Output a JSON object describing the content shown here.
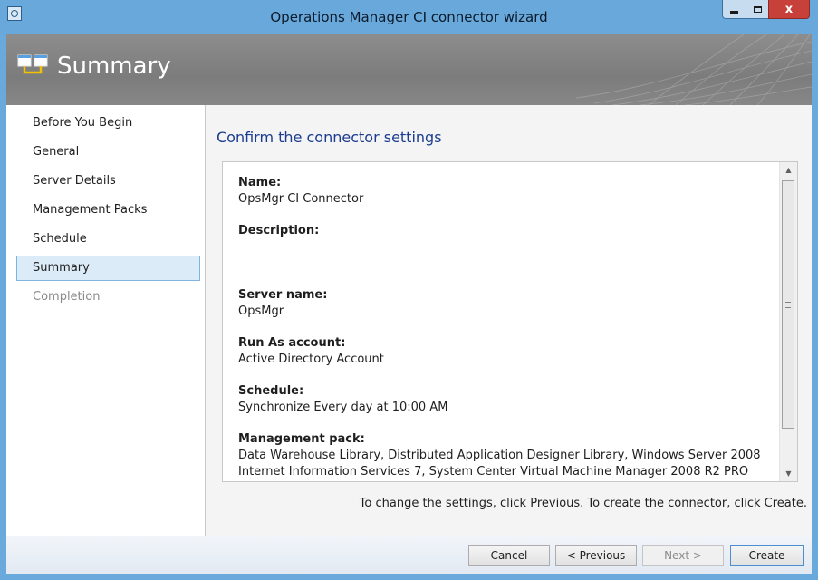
{
  "window": {
    "title": "Operations Manager CI connector wizard",
    "close_glyph": "x"
  },
  "banner": {
    "title": "Summary",
    "icon": "summary-windows-icon"
  },
  "nav": {
    "items": [
      {
        "label": "Before You Begin",
        "state": "normal"
      },
      {
        "label": "General",
        "state": "normal"
      },
      {
        "label": "Server Details",
        "state": "normal"
      },
      {
        "label": "Management Packs",
        "state": "normal"
      },
      {
        "label": "Schedule",
        "state": "normal"
      },
      {
        "label": "Summary",
        "state": "selected"
      },
      {
        "label": "Completion",
        "state": "disabled"
      }
    ]
  },
  "main": {
    "heading": "Confirm the connector settings",
    "fields": [
      {
        "label": "Name:",
        "value": "OpsMgr CI Connector"
      },
      {
        "label": "Description:",
        "value": ""
      },
      {
        "label": "Server name:",
        "value": "OpsMgr"
      },
      {
        "label": "Run As account:",
        "value": "Active Directory Account"
      },
      {
        "label": "Schedule:",
        "value": "Synchronize Every day at 10:00 AM"
      },
      {
        "label": "Management pack:",
        "value": "Data Warehouse Library, Distributed Application Designer Library, Windows Server 2008",
        "value2": "Internet Information Services 7, System Center Virtual Machine Manager 2008 R2 PRO"
      }
    ],
    "hint": "To change the settings, click Previous. To create the connector, click Create."
  },
  "footer": {
    "cancel": "Cancel",
    "previous": "< Previous",
    "next": "Next >",
    "create": "Create"
  },
  "colors": {
    "window_frame": "#6aa9dc",
    "heading": "#1b3c8f",
    "banner": "#8a8a8a"
  }
}
